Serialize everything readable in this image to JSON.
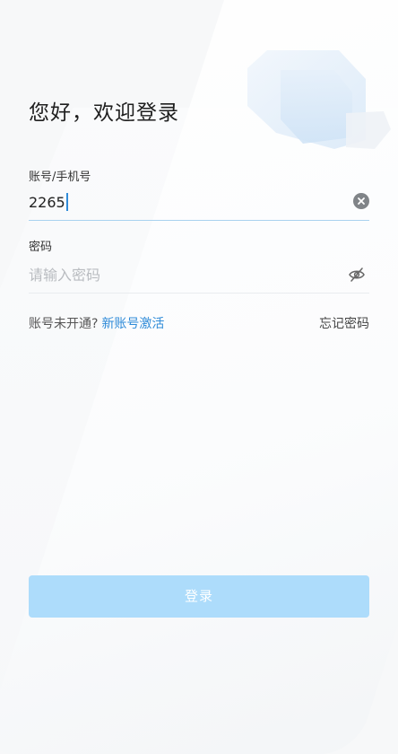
{
  "header": {
    "greeting": "您好，欢迎登录"
  },
  "account": {
    "label": "账号/手机号",
    "value": "2265"
  },
  "password": {
    "label": "密码",
    "placeholder": "请输入密码"
  },
  "links": {
    "not_activated_text": "账号未开通?",
    "activate_label": "新账号激活",
    "forgot_label": "忘记密码"
  },
  "login": {
    "label": "登录"
  },
  "icons": {
    "clear": "clear-circle-icon",
    "eye": "eye-off-icon",
    "decoration": "cube-decoration-icon"
  },
  "colors": {
    "accent": "#2f8bd8",
    "button_disabled": "#addcfb",
    "background": "#f7f8f9"
  }
}
